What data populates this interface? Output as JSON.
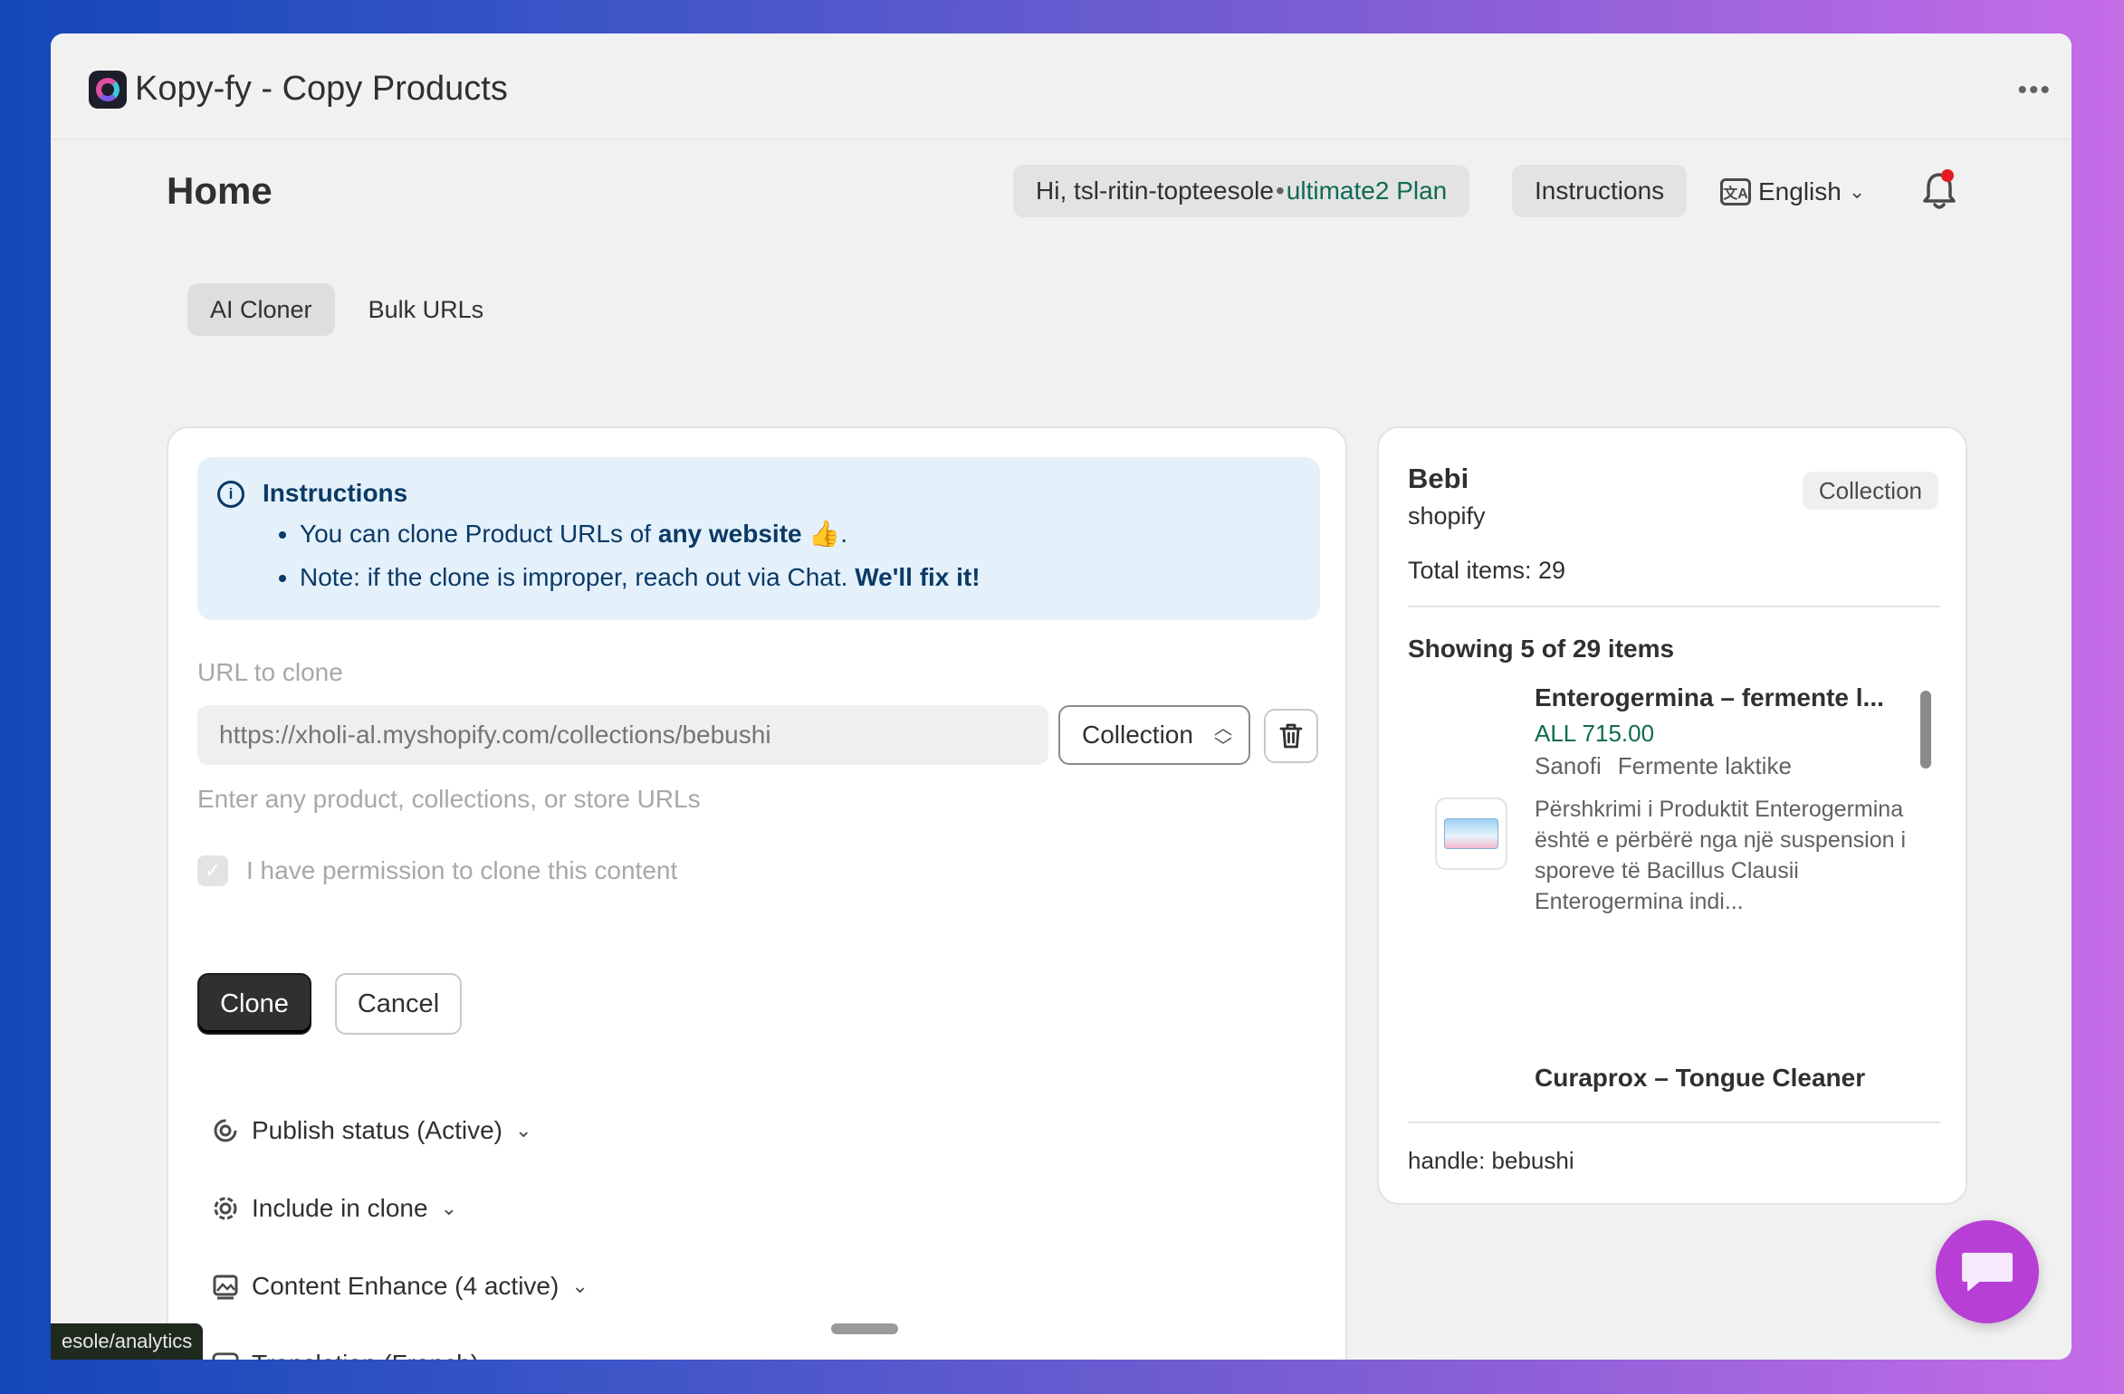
{
  "app": {
    "title": "Kopy-fy - Copy Products",
    "more_icon": "more-horizontal-icon"
  },
  "header": {
    "page_title": "Home",
    "greeting": "Hi, tsl-ritin-topteesole",
    "plan": "ultimate2 Plan",
    "instructions_label": "Instructions",
    "language": "English"
  },
  "tabs": [
    {
      "label": "AI Cloner",
      "active": true
    },
    {
      "label": "Bulk URLs",
      "active": false
    }
  ],
  "instructions": {
    "title": "Instructions",
    "line1_prefix": "You can clone Product URLs of ",
    "line1_bold": "any website",
    "line1_suffix": " 👍.",
    "line2_prefix": "Note: if the clone is improper, reach out via Chat. ",
    "line2_bold": "We'll fix it!"
  },
  "form": {
    "url_label": "URL to clone",
    "url_placeholder": "https://xholi-al.myshopify.com/collections/bebushi",
    "type_value": "Collection",
    "url_help": "Enter any product, collections, or store URLs",
    "permission_label": "I have permission to clone this content",
    "permission_checked": true,
    "clone_label": "Clone",
    "cancel_label": "Cancel"
  },
  "sections": [
    {
      "label": "Publish status (Active)",
      "icon": "publish-icon",
      "expanded": false
    },
    {
      "label": "Include in clone",
      "icon": "gear-icon",
      "expanded": false
    },
    {
      "label": "Content Enhance (4 active)",
      "icon": "image-enhance-icon",
      "expanded": false
    },
    {
      "label": "Translation (French)",
      "icon": "translate-icon",
      "expanded": true
    }
  ],
  "preview": {
    "name": "Bebi",
    "source": "shopify",
    "badge": "Collection",
    "total": "Total items: 29",
    "showing": "Showing 5 of 29 items",
    "products": [
      {
        "title": "Enterogermina – fermente l...",
        "price": "ALL 715.00",
        "vendor": "Sanofi",
        "category": "Fermente laktike",
        "description": "Përshkrimi i Produktit Enterogermina është e përbërë nga një suspension i sporeve të Bacillus Clausii Enterogermina indi..."
      },
      {
        "title": "Curaprox – Tongue Cleaner"
      }
    ],
    "handle": "handle: bebushi"
  },
  "status_bar": {
    "url": "esole/analytics"
  },
  "colors": {
    "accent_green": "#0f6b53",
    "info_bg": "#e4f1fb",
    "info_text": "#0b3a66",
    "chat_purple": "#b83fd6",
    "notification_red": "#e51c23"
  }
}
